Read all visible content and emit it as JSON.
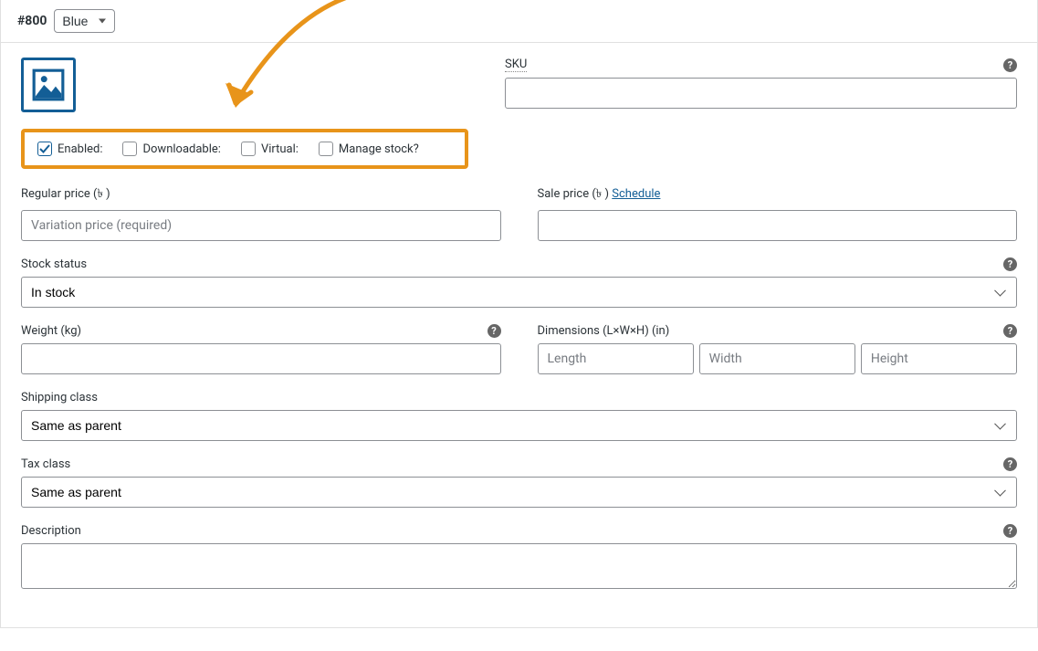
{
  "header": {
    "variation_id": "#800",
    "attribute_value": "Blue"
  },
  "checkboxes": {
    "enabled": {
      "label": "Enabled:",
      "checked": true
    },
    "downloadable": {
      "label": "Downloadable:",
      "checked": false
    },
    "virtual": {
      "label": "Virtual:",
      "checked": false
    },
    "manage_stock": {
      "label": "Manage stock?",
      "checked": false
    }
  },
  "fields": {
    "sku": {
      "label": "SKU",
      "value": ""
    },
    "regular_price": {
      "label": "Regular price (৳ )",
      "placeholder": "Variation price (required)",
      "value": ""
    },
    "sale_price": {
      "label": "Sale price (৳ )",
      "schedule_link": "Schedule",
      "value": ""
    },
    "stock_status": {
      "label": "Stock status",
      "value": "In stock"
    },
    "weight": {
      "label": "Weight (kg)",
      "value": ""
    },
    "dimensions": {
      "label": "Dimensions (L×W×H) (in)",
      "length_ph": "Length",
      "width_ph": "Width",
      "height_ph": "Height"
    },
    "shipping_class": {
      "label": "Shipping class",
      "value": "Same as parent"
    },
    "tax_class": {
      "label": "Tax class",
      "value": "Same as parent"
    },
    "description": {
      "label": "Description",
      "value": ""
    }
  },
  "help_glyph": "?",
  "colors": {
    "highlight": "#e8941a",
    "link": "#135e96"
  }
}
